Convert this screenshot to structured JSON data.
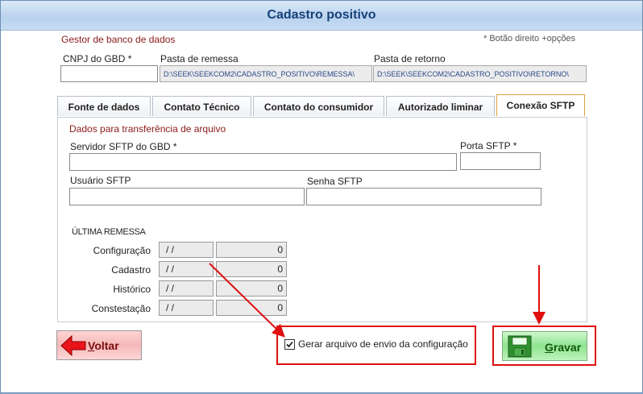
{
  "window": {
    "title": "Cadastro positivo"
  },
  "header": {
    "section_label": "Gestor de banco de dados",
    "hint": "* Botão direito +opções",
    "cnpj_label": "CNPJ do GBD *",
    "cnpj_value": "",
    "remessa_label": "Pasta de remessa",
    "remessa_value": "D:\\SEEK\\SEEKCOM2\\CADASTRO_POSITIVO\\REMESSA\\",
    "retorno_label": "Pasta de retorno",
    "retorno_value": "D:\\SEEK\\SEEKCOM2\\CADASTRO_POSITIVO\\RETORNO\\"
  },
  "tabs": [
    {
      "label": "Fonte de dados"
    },
    {
      "label": "Contato Técnico"
    },
    {
      "label": "Contato do consumidor"
    },
    {
      "label": "Autorizado liminar"
    },
    {
      "label": "Conexão SFTP"
    }
  ],
  "sftp": {
    "section_label": "Dados para transferência de arquivo",
    "server_label": "Servidor SFTP do GBD *",
    "server_value": "",
    "port_label": "Porta SFTP *",
    "port_value": "",
    "user_label": "Usuário SFTP",
    "user_value": "",
    "password_label": "Senha SFTP",
    "password_value": ""
  },
  "ultima_remessa": {
    "title": "ÚLTIMA REMESSA",
    "rows": [
      {
        "label": "Configuração",
        "date": "/ /",
        "count": "0"
      },
      {
        "label": "Cadastro",
        "date": "/ /",
        "count": "0"
      },
      {
        "label": "Histórico",
        "date": "/ /",
        "count": "0"
      },
      {
        "label": "Constestação",
        "date": "/ /",
        "count": "0"
      }
    ]
  },
  "footer": {
    "voltar_label": "Voltar",
    "checkbox_label": "Gerar arquivo de envio da configuração",
    "checkbox_checked": true,
    "gravar_label": "Gravar"
  },
  "colors": {
    "annotation": "#e01010",
    "title": "#16407a",
    "section": "#8b1a1a"
  }
}
